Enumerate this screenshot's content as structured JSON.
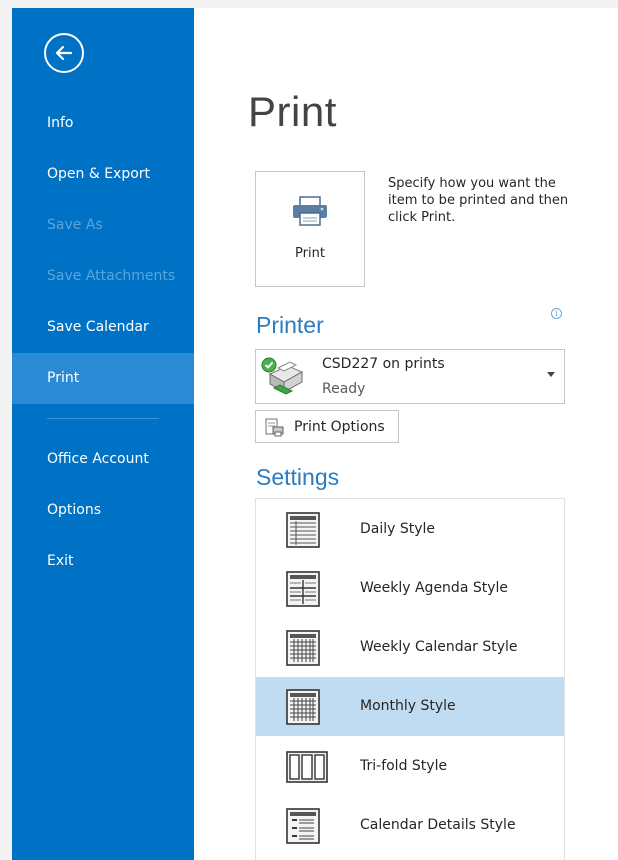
{
  "sidebar": {
    "back_icon": "back-arrow-icon",
    "items": [
      {
        "label": "Info",
        "state": "normal"
      },
      {
        "label": "Open & Export",
        "state": "normal"
      },
      {
        "label": "Save As",
        "state": "disabled"
      },
      {
        "label": "Save Attachments",
        "state": "disabled"
      },
      {
        "label": "Save Calendar",
        "state": "normal"
      },
      {
        "label": "Print",
        "state": "active"
      },
      {
        "label": "Office Account",
        "state": "normal"
      },
      {
        "label": "Options",
        "state": "normal"
      },
      {
        "label": "Exit",
        "state": "normal"
      }
    ],
    "color": "#0072c6",
    "active_color": "#2a8ad4"
  },
  "main": {
    "title": "Print",
    "print_button": {
      "label": "Print",
      "icon": "printer-icon"
    },
    "description": "Specify how you want the item to be printed and then click Print.",
    "printer_heading": "Printer",
    "printer": {
      "name": "CSD227 on prints",
      "status": "Ready",
      "icon": "printer-ready-icon"
    },
    "print_options_label": "Print Options",
    "settings_heading": "Settings",
    "styles": [
      {
        "label": "Daily Style",
        "icon": "daily-style-icon",
        "selected": false
      },
      {
        "label": "Weekly Agenda Style",
        "icon": "weekly-agenda-style-icon",
        "selected": false
      },
      {
        "label": "Weekly Calendar Style",
        "icon": "weekly-calendar-style-icon",
        "selected": false
      },
      {
        "label": "Monthly Style",
        "icon": "monthly-style-icon",
        "selected": true
      },
      {
        "label": "Tri-fold Style",
        "icon": "tri-fold-style-icon",
        "selected": false
      },
      {
        "label": "Calendar Details Style",
        "icon": "calendar-details-style-icon",
        "selected": false
      }
    ],
    "accent_color": "#2b7cc0",
    "selected_color": "#bfdcf2"
  }
}
